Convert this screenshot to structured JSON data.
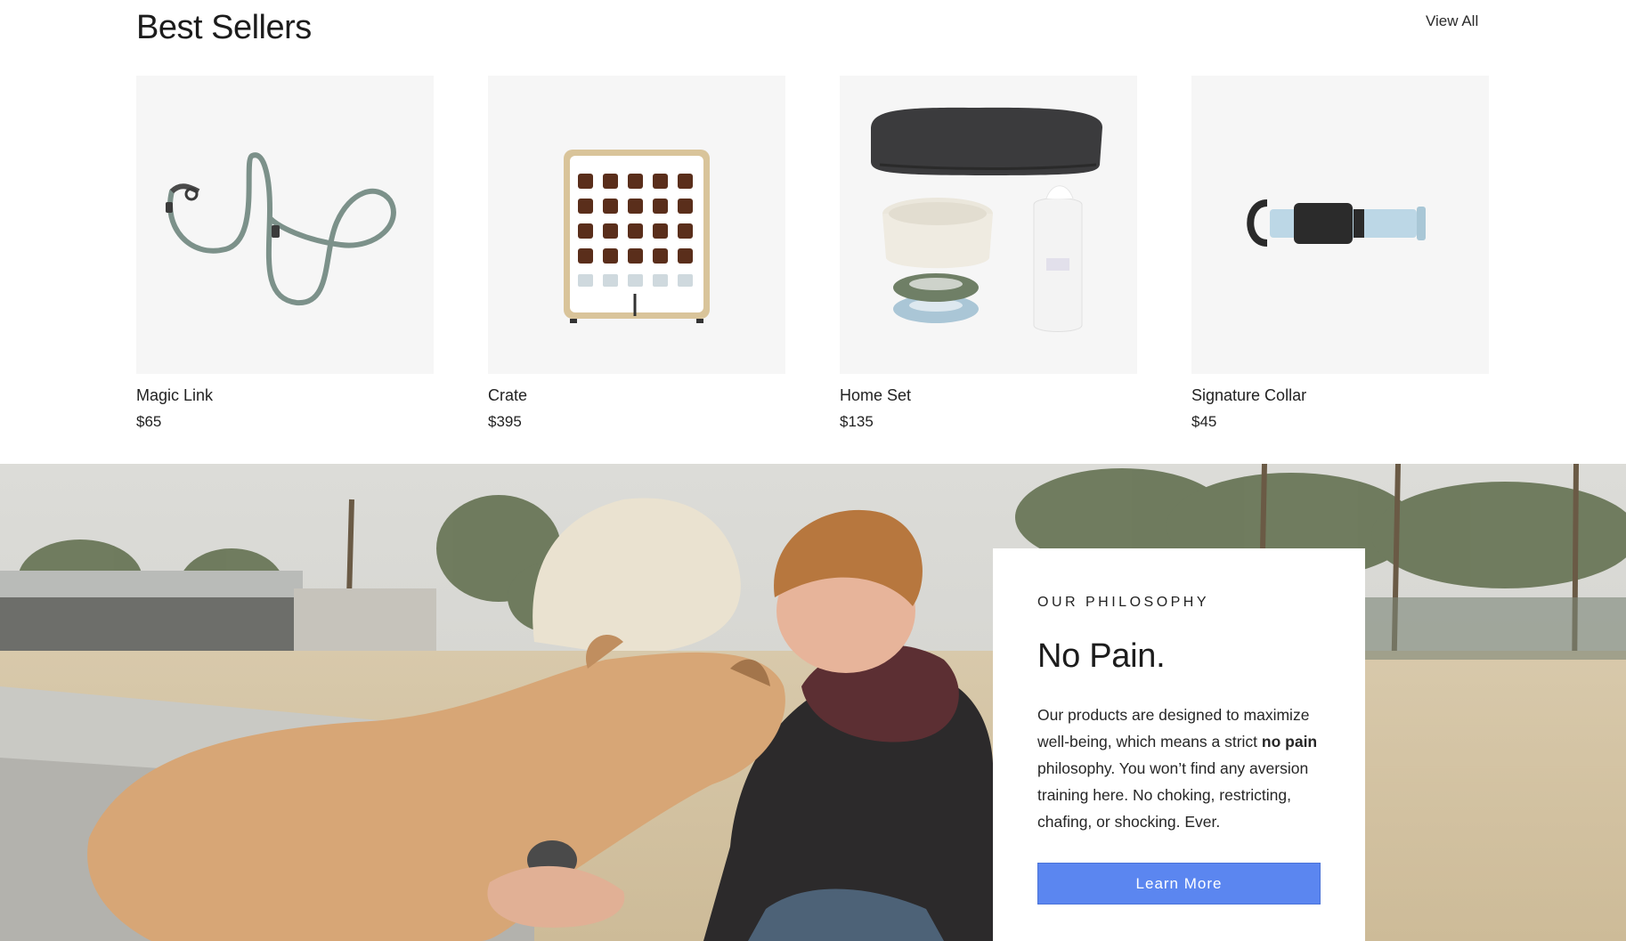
{
  "best_sellers": {
    "title": "Best Sellers",
    "view_all": "View All",
    "products": [
      {
        "name": "Magic Link",
        "price": "$65"
      },
      {
        "name": "Crate",
        "price": "$395"
      },
      {
        "name": "Home Set",
        "price": "$135"
      },
      {
        "name": "Signature Collar",
        "price": "$45"
      }
    ]
  },
  "philosophy": {
    "eyebrow": "OUR PHILOSOPHY",
    "title": "No Pain.",
    "text_before": "Our products are designed to maximize well-being, which means a strict ",
    "text_bold": "no pain",
    "text_after": " philosophy. You won’t find any aversion training here. No choking, restricting, chafing, or shocking. Ever.",
    "button": "Learn More"
  },
  "colors": {
    "accent_button": "#5b86f0",
    "thumb_background": "#f6f6f6"
  }
}
